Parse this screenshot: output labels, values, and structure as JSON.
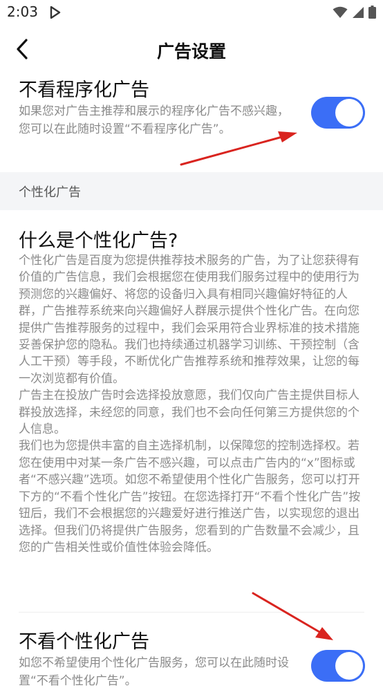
{
  "status_bar": {
    "time": "2:03",
    "icons": [
      "play-store-icon",
      "wifi-icon",
      "signal-icon",
      "battery-icon"
    ]
  },
  "header": {
    "title": "广告设置",
    "back_icon": "chevron-left-icon"
  },
  "programmatic": {
    "title": "不看程序化广告",
    "description": "如果您对广告主推荐和展示的程序化广告不感兴趣，您可以在此随时设置“不看程序化广告”。",
    "toggle_on": true
  },
  "group_header": {
    "label": "个性化广告"
  },
  "personalized_info": {
    "title": "什么是个性化广告?",
    "paragraphs": [
      "个性化广告是百度为您提供推荐技术服务的广告，为了让您获得有价值的广告信息，我们会根据您在使用我们服务过程中的使用行为预测您的兴趣偏好、将您的设备归入具有相同兴趣偏好特征的人群，广告推荐系统来向兴趣偏好人群展示提供个性化广告。在向您提供广告推荐服务的过程中，我们会采用符合业界标准的技术措施妥善保护您的隐私。我们也持续通过机器学习训练、干预控制（含人工干预）等手段，不断优化广告推荐系统和推荐效果，让您的每一次浏览都有价值。",
      "广告主在投放广告时会选择投放意愿，我们仅向广告主提供目标人群投放选择，未经您的同意，我们也不会向任何第三方提供您的个人信息。",
      "我们也为您提供丰富的自主选择机制，以保障您的控制选择权。若您在使用中对某一条广告不感兴趣，可以点击广告内的“x”图标或者“不感兴趣”选项。如您不希望使用个性化广告服务，您可以打开下方的“不看个性化广告”按钮。在您选择打开“不看个性化广告”按钮后，我们不会根据您的兴趣爱好进行推送广告，以实现您的退出选择。但我们仍将提供广告服务，您看到的广告数量不会减少，且您的广告相关性或价值性体验会降低。"
    ]
  },
  "personalized_opt_out": {
    "title": "不看个性化广告",
    "description": "如您不希望使用个性化广告服务，您可以在此随时设置“不看个性化广告”。",
    "toggle_on": true
  },
  "colors": {
    "accent": "#3b6ef6",
    "annotation_arrow": "#d9241f",
    "group_header_bg": "#f4f5f7"
  }
}
